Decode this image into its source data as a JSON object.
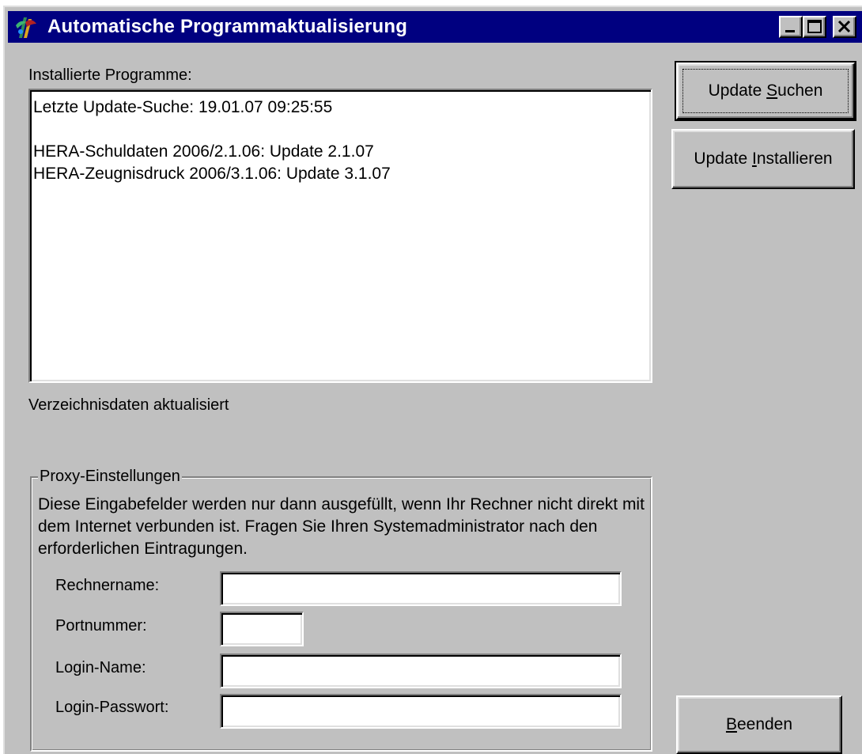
{
  "window": {
    "title": "Automatische Programmaktualisierung"
  },
  "installed": {
    "label": "Installierte Programme:",
    "lines": [
      "Letzte Update-Suche: 19.01.07 09:25:55",
      "",
      "HERA-Schuldaten 2006/2.1.06: Update 2.1.07",
      "HERA-Zeugnisdruck 2006/3.1.06: Update 3.1.07"
    ]
  },
  "status": {
    "text": "Verzeichnisdaten aktualisiert"
  },
  "buttons": {
    "search": {
      "before": "Update ",
      "mnemonic": "S",
      "after": "uchen"
    },
    "install": {
      "before": "Update ",
      "mnemonic": "I",
      "after": "nstallieren"
    },
    "quit": {
      "before": "",
      "mnemonic": "B",
      "after": "eenden"
    }
  },
  "proxy": {
    "title": "Proxy-Einstellungen",
    "description": "Diese Eingabefelder werden nur dann ausgefüllt, wenn Ihr Rechner nicht direkt mit dem Internet verbunden ist. Fragen Sie Ihren Systemadministrator nach den erforderlichen Eintragungen.",
    "hostname_label": "Rechnername:",
    "hostname_value": "",
    "port_label": "Portnummer:",
    "port_value": "",
    "login_label": "Login-Name:",
    "login_value": "",
    "password_label": "Login-Passwort:",
    "password_value": ""
  }
}
